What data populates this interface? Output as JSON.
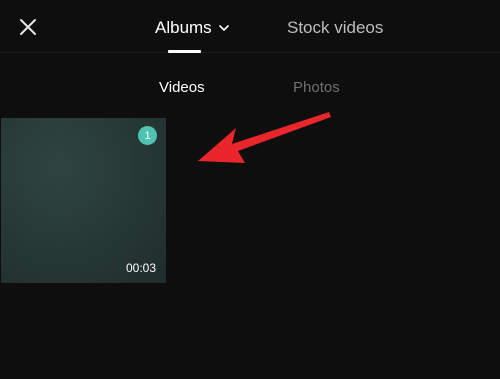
{
  "header": {
    "close_icon": "close-icon",
    "albums_label": "Albums",
    "albums_chevron_icon": "chevron-down-icon",
    "stock_videos_label": "Stock videos"
  },
  "subtabs": {
    "videos_label": "Videos",
    "photos_label": "Photos"
  },
  "media": [
    {
      "selection_index": "1",
      "duration": "00:03"
    }
  ],
  "colors": {
    "background": "#0e0e0e",
    "selection_badge": "#4fc3b3",
    "annotation_arrow": "#e8262b",
    "inactive_tab": "#6f6f6f"
  }
}
